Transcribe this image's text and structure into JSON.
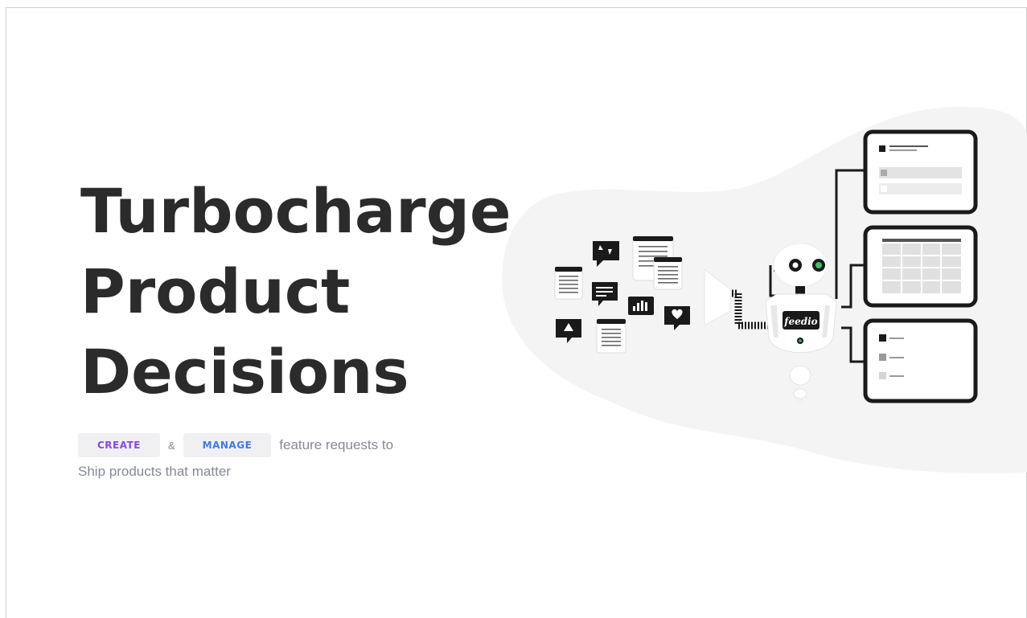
{
  "hero": {
    "headline": [
      "Turbocharge",
      "Product",
      "Decisions"
    ],
    "create_tag": "CREATE",
    "ampersand": "&",
    "manage_tag": "MANAGE",
    "line1_rest": "feature requests to",
    "line2": "Ship products that matter"
  },
  "illustration": {
    "robot_badge": "feedio"
  },
  "colors": {
    "headline": "#2b2b2b",
    "create_tag": "#8a47e0",
    "manage_tag": "#3d7be8",
    "body_text": "#85889a",
    "robot_eye_accent": "#3fbf6a"
  }
}
